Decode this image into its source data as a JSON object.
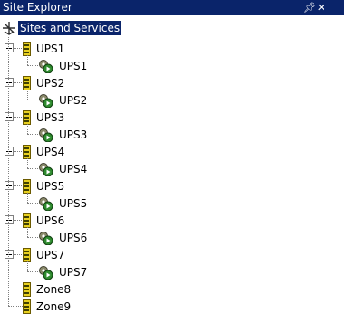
{
  "window": {
    "title": "Site Explorer",
    "pin_icon": "pushpin-icon",
    "close_icon": "close-icon"
  },
  "tree": {
    "root": {
      "label": "Sites and Services",
      "icon": "sites-root-icon",
      "selected": true
    },
    "groups": [
      {
        "label": "UPS1",
        "child": "UPS1"
      },
      {
        "label": "UPS2",
        "child": "UPS2"
      },
      {
        "label": "UPS3",
        "child": "UPS3"
      },
      {
        "label": "UPS4",
        "child": "UPS4"
      },
      {
        "label": "UPS5",
        "child": "UPS5"
      },
      {
        "label": "UPS6",
        "child": "UPS6"
      },
      {
        "label": "UPS7",
        "child": "UPS7"
      }
    ],
    "leaves": [
      {
        "label": "Zone8"
      },
      {
        "label": "Zone9"
      }
    ]
  },
  "colors": {
    "titlebar": "#0a246a",
    "selection": "#0a246a",
    "zone_yellow": "#e8d020",
    "service_green": "#2e8b2e"
  }
}
